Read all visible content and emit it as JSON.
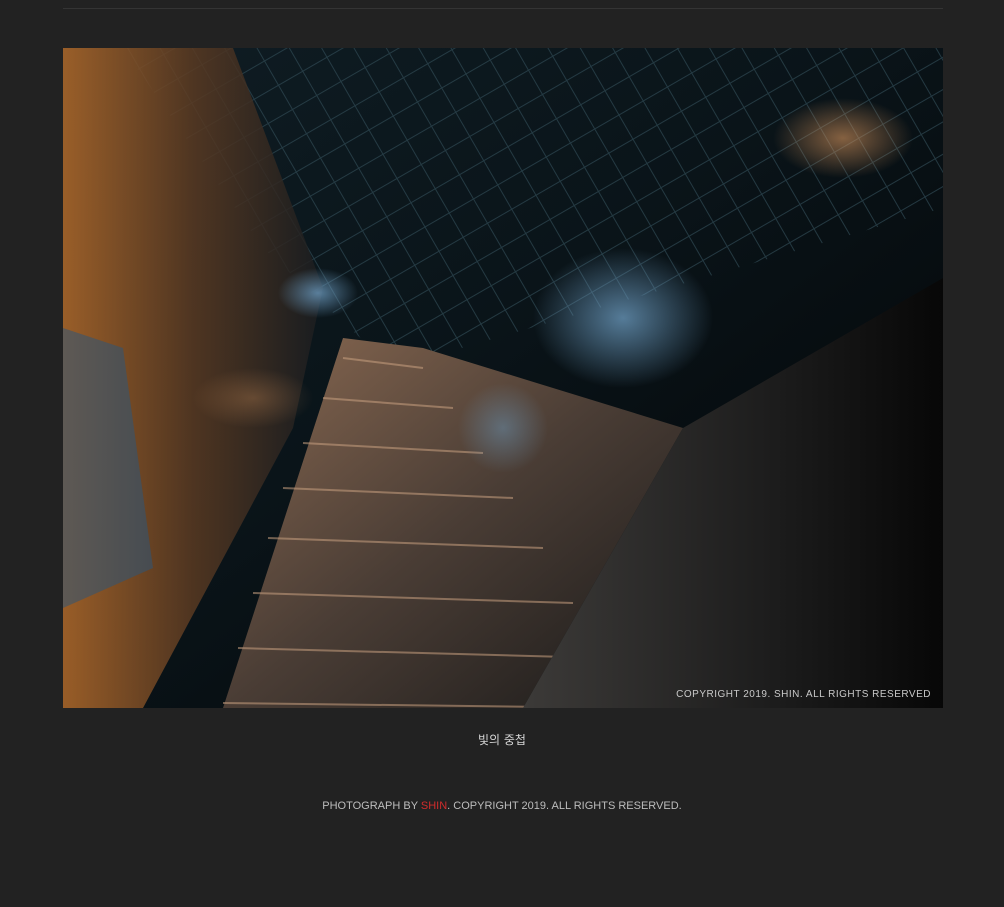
{
  "photo": {
    "watermark": "COPYRIGHT 2019. SHIN. ALL RIGHTS RESERVED"
  },
  "caption": {
    "title": "빛의 중첩"
  },
  "footer": {
    "prefix": "PHOTOGRAPH BY ",
    "author": "SHIN",
    "suffix": ". COPYRIGHT 2019. ALL RIGHTS RESERVED."
  },
  "colors": {
    "background": "#222222",
    "author_accent": "#d02c2c",
    "text": "#bdbdbd"
  }
}
